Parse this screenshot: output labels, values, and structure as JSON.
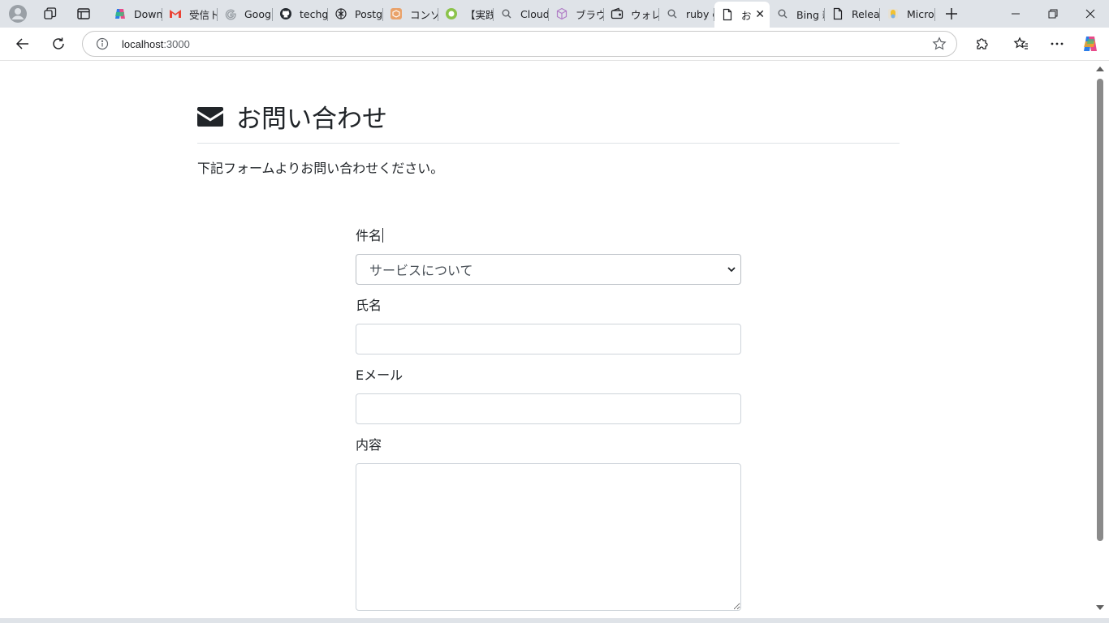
{
  "browser": {
    "tabs": [
      {
        "title": "Downl",
        "icon": "copilot-icon"
      },
      {
        "title": "受信ト",
        "icon": "gmail-icon"
      },
      {
        "title": "Googl",
        "icon": "google-icon"
      },
      {
        "title": "techg",
        "icon": "github-icon"
      },
      {
        "title": "Postgr",
        "icon": "chatgpt-icon"
      },
      {
        "title": "コンソー",
        "icon": "aws-icon"
      },
      {
        "title": "【実践",
        "icon": "green-circle-icon"
      },
      {
        "title": "Cloud",
        "icon": "search-icon"
      },
      {
        "title": "ブラウ",
        "icon": "cube-icon"
      },
      {
        "title": "ウォレッ",
        "icon": "wallet-icon"
      },
      {
        "title": "ruby c",
        "icon": "search-icon"
      },
      {
        "title": "お",
        "icon": "page-icon",
        "active": true
      },
      {
        "title": "Bing 新",
        "icon": "search-icon"
      },
      {
        "title": "Releas",
        "icon": "page-icon"
      },
      {
        "title": "Micro",
        "icon": "microsoft-icon"
      }
    ],
    "address": {
      "host": "localhost",
      "port": ":3000"
    }
  },
  "page": {
    "title": "お問い合わせ",
    "lead": "下記フォームよりお問い合わせください。",
    "form": {
      "subject_label": "件名",
      "subject_value": "サービスについて",
      "name_label": "氏名",
      "email_label": "Eメール",
      "content_label": "内容"
    }
  }
}
